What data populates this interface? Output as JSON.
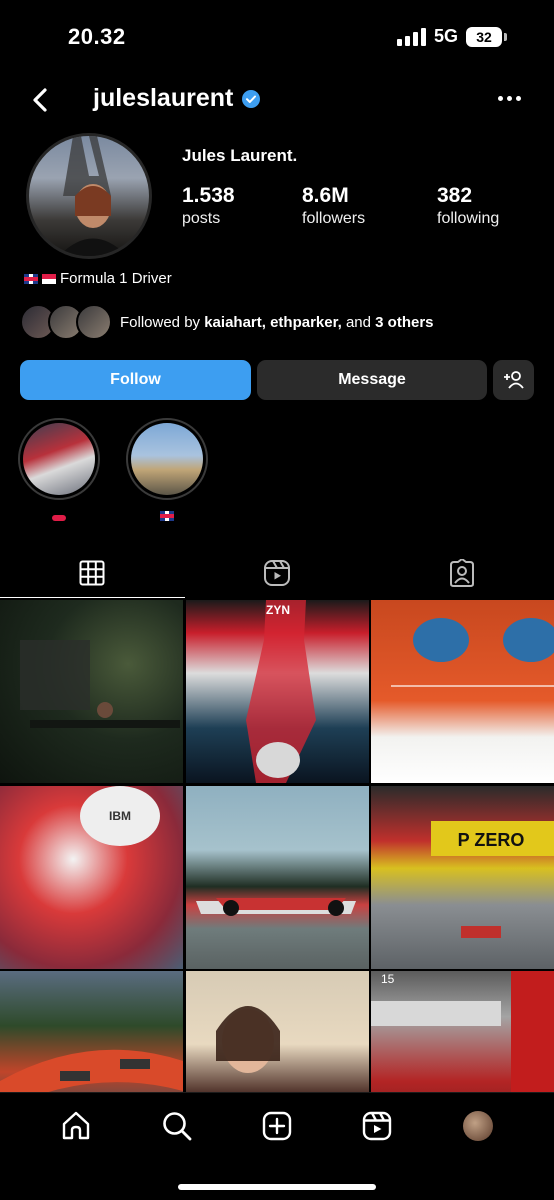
{
  "status_bar": {
    "time": "20.32",
    "network": "5G",
    "battery": "32"
  },
  "header": {
    "username": "julesl‌aurent"
  },
  "profile": {
    "display_name": "Jules Laurent.",
    "stats": [
      {
        "value": "1.538",
        "label": "posts"
      },
      {
        "value": "8.6M",
        "label": "followers"
      },
      {
        "value": "382",
        "label": "following"
      }
    ],
    "bio": "Formula 1 Driver",
    "followed_by": {
      "prefix": "Followed by ",
      "names": "kaiahart, ethparker,",
      "middle": " and ",
      "others": "3 others"
    }
  },
  "buttons": {
    "follow": "Follow",
    "message": "Message"
  },
  "highlights": [
    {
      "label": ""
    },
    {
      "label": ""
    }
  ],
  "colors": {
    "accent": "#3d9ef1",
    "secondary_button": "#2b2b2b",
    "background": "#000000"
  },
  "tabs": [
    {
      "icon": "grid-icon",
      "active": true
    },
    {
      "icon": "reels-icon",
      "active": false
    },
    {
      "icon": "tagged-icon",
      "active": false
    }
  ],
  "bottom_nav": [
    "home-icon",
    "search-icon",
    "create-icon",
    "reels-icon",
    "profile-avatar"
  ]
}
